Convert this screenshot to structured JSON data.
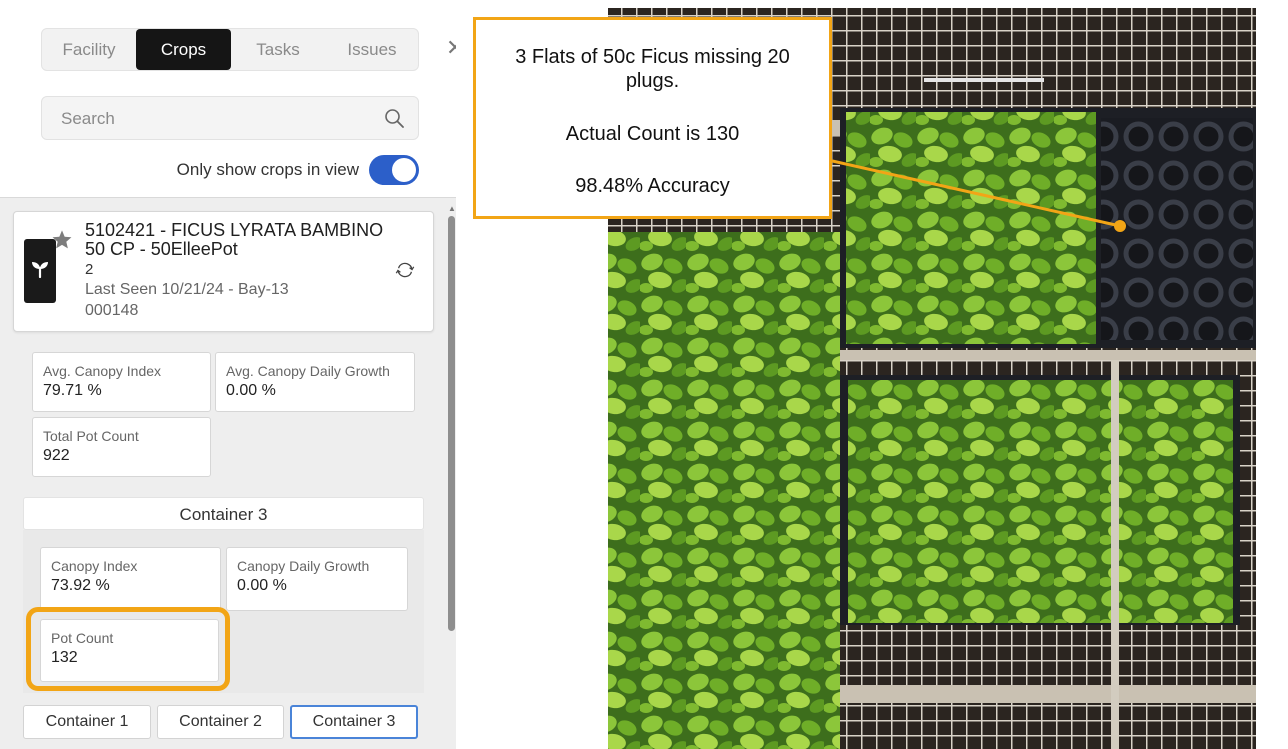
{
  "tabs": {
    "items": [
      {
        "label": "Facility"
      },
      {
        "label": "Crops"
      },
      {
        "label": "Tasks"
      },
      {
        "label": "Issues"
      }
    ],
    "active": "Crops"
  },
  "search": {
    "placeholder": "Search"
  },
  "toggle": {
    "label": "Only show crops in view",
    "on": true
  },
  "crop": {
    "title": "5102421 - FICUS LYRATA BAMBINO 50 CP - 50ElleePot",
    "sub": "2",
    "last_seen": "Last Seen 10/21/24 - Bay-13",
    "code": "000148"
  },
  "summary": {
    "avg_canopy_index": {
      "label": "Avg. Canopy Index",
      "value": "79.71 %"
    },
    "avg_canopy_growth": {
      "label": "Avg. Canopy Daily Growth",
      "value": "0.00 %"
    },
    "total_pot_count": {
      "label": "Total Pot Count",
      "value": "922"
    }
  },
  "container": {
    "header": "Container 3",
    "canopy_index": {
      "label": "Canopy Index",
      "value": "73.92 %"
    },
    "canopy_growth": {
      "label": "Canopy Daily Growth",
      "value": "0.00 %"
    },
    "pot_count": {
      "label": "Pot Count",
      "value": "132"
    }
  },
  "container_buttons": [
    {
      "label": "Container 1"
    },
    {
      "label": "Container 2"
    },
    {
      "label": "Container 3"
    }
  ],
  "callout": {
    "line1": "3 Flats of 50c Ficus missing 20",
    "line2": "plugs.",
    "line3": "Actual Count is 130",
    "line4": "98.48% Accuracy"
  },
  "colors": {
    "accent_orange": "#f2a516",
    "toggle_blue": "#2c5fc9",
    "active_tab_bg": "#151515",
    "selected_button_border": "#4a84d8"
  }
}
